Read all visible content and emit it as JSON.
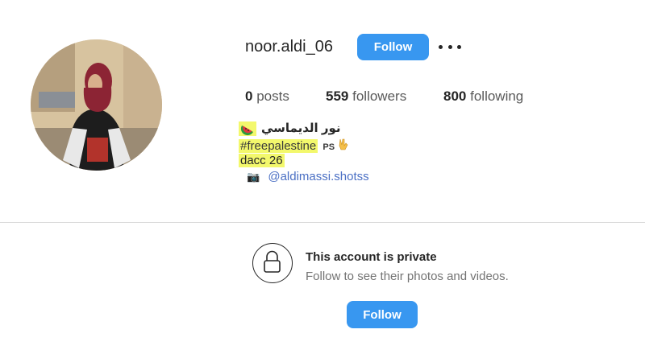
{
  "profile": {
    "username": "noor.aldi_06",
    "follow_label": "Follow",
    "more_icon": "ellipsis-icon",
    "avatar_icon": "profile-photo"
  },
  "stats": {
    "posts_count": "0",
    "posts_label": "posts",
    "followers_count": "559",
    "followers_label": "followers",
    "following_count": "800",
    "following_label": "following"
  },
  "bio": {
    "name_emoji_icon": "watermelon-icon",
    "display_name": "نور الديماسي",
    "hashtag": "#freepalestine",
    "flag_text": "PS",
    "hand_icon": "victory-hand-icon",
    "line3": "dacc 26",
    "camera_icon": "camera-icon",
    "link": "@aldimassi.shotss"
  },
  "private_notice": {
    "icon": "lock-icon",
    "title": "This account is private",
    "subtitle": "Follow to see their photos and videos.",
    "follow_label": "Follow"
  },
  "colors": {
    "accent": "#3897f0",
    "highlight": "#f3f86c",
    "link": "#4a6fc4",
    "divider": "#dbdbdb"
  }
}
